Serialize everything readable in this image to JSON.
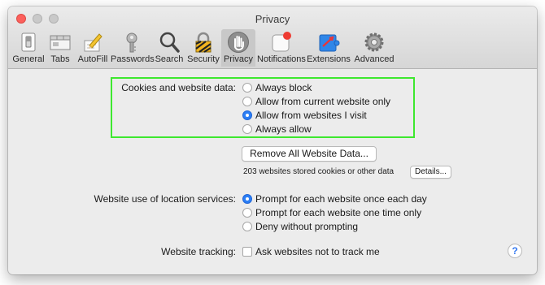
{
  "window": {
    "title": "Privacy"
  },
  "toolbar": {
    "tabs": [
      {
        "label": "General",
        "icon": "switch-icon"
      },
      {
        "label": "Tabs",
        "icon": "tabs-icon"
      },
      {
        "label": "AutoFill",
        "icon": "pencil-icon"
      },
      {
        "label": "Passwords",
        "icon": "key-icon"
      },
      {
        "label": "Search",
        "icon": "magnifier-icon"
      },
      {
        "label": "Security",
        "icon": "lock-icon"
      },
      {
        "label": "Privacy",
        "icon": "hand-icon",
        "selected": true
      },
      {
        "label": "Notifications",
        "icon": "notification-icon"
      },
      {
        "label": "Extensions",
        "icon": "puzzle-icon"
      },
      {
        "label": "Advanced",
        "icon": "gear-icon"
      }
    ]
  },
  "cookies": {
    "label": "Cookies and website data:",
    "options": [
      {
        "label": "Always block",
        "selected": false
      },
      {
        "label": "Allow from current website only",
        "selected": false
      },
      {
        "label": "Allow from websites I visit",
        "selected": true
      },
      {
        "label": "Always allow",
        "selected": false
      }
    ],
    "remove_button": "Remove All Website Data...",
    "stored_text": "203 websites stored cookies or other data",
    "details_button": "Details..."
  },
  "location": {
    "label": "Website use of location services:",
    "options": [
      {
        "label": "Prompt for each website once each day",
        "selected": true
      },
      {
        "label": "Prompt for each website one time only",
        "selected": false
      },
      {
        "label": "Deny without prompting",
        "selected": false
      }
    ]
  },
  "tracking": {
    "label": "Website tracking:",
    "checkbox_label": "Ask websites not to track me",
    "checked": false
  },
  "help": {
    "symbol": "?"
  },
  "colors": {
    "highlight_box": "#3ee82f",
    "accent": "#2b7ef5",
    "close": "#fc605c"
  }
}
